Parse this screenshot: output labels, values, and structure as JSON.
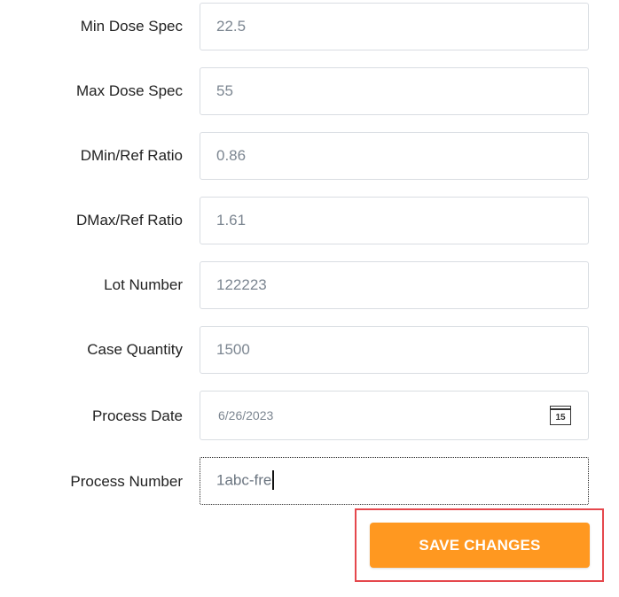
{
  "form": {
    "fields": [
      {
        "label": "Min Dose Spec",
        "value": "22.5"
      },
      {
        "label": "Max Dose Spec",
        "value": "55"
      },
      {
        "label": "DMin/Ref Ratio",
        "value": "0.86"
      },
      {
        "label": "DMax/Ref Ratio",
        "value": "1.61"
      },
      {
        "label": "Lot Number",
        "value": "122223"
      },
      {
        "label": "Case Quantity",
        "value": "1500"
      },
      {
        "label": "Process Date",
        "value": "6/26/2023",
        "icon": "calendar-icon",
        "icon_text": "15"
      },
      {
        "label": "Process Number",
        "value": "1abc-fre"
      }
    ]
  },
  "actions": {
    "save_label": "SAVE CHANGES",
    "save_color": "#ff9820",
    "highlight_color": "#e5484d"
  }
}
